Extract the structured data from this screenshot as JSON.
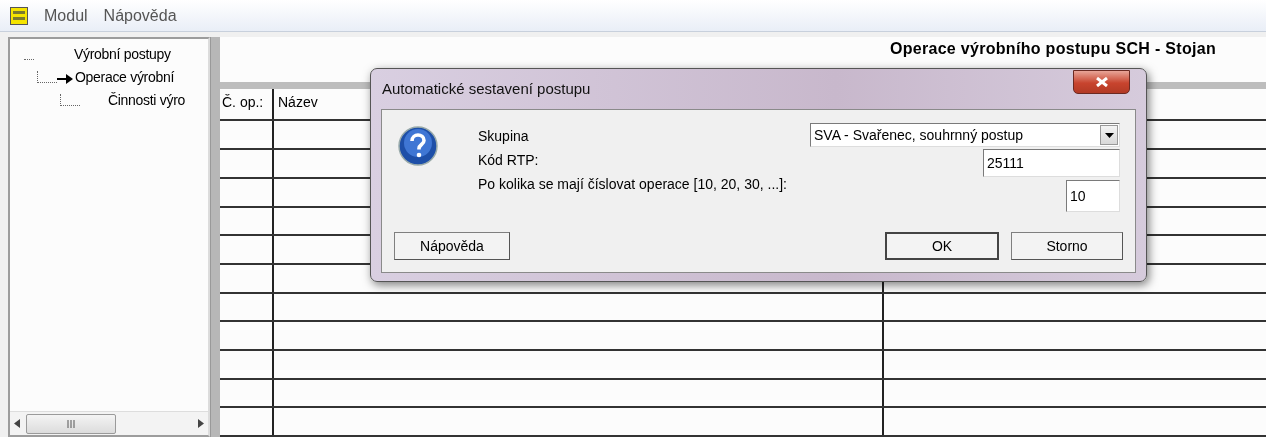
{
  "menu": [
    "Modul",
    "Nápověda"
  ],
  "tree": [
    {
      "label": "Výrobní postupy",
      "current": false,
      "children": [
        {
          "label": "Operace výrobní",
          "current": true,
          "children": [
            {
              "label": "Činnosti výro",
              "current": false
            }
          ]
        }
      ]
    }
  ],
  "main": {
    "title": "Operace výrobního postupu SCH - Stojan",
    "columns": [
      "Č. op.:",
      "Název"
    ]
  },
  "dialog": {
    "title": "Automatické sestavení postupu",
    "fields": [
      {
        "kind": "combo",
        "label": "Skupina",
        "value": "SVA - Svařenec, souhrnný postup"
      },
      {
        "kind": "text",
        "label": "Kód RTP:",
        "value": "25111"
      },
      {
        "kind": "number",
        "label": "Po kolika se mají číslovat operace [10, 20, 30, ...]:",
        "value": "10"
      }
    ],
    "buttons": [
      {
        "label": "Nápověda",
        "default": false
      },
      {
        "label": "OK",
        "default": true
      },
      {
        "label": "Storno",
        "default": false
      }
    ]
  }
}
